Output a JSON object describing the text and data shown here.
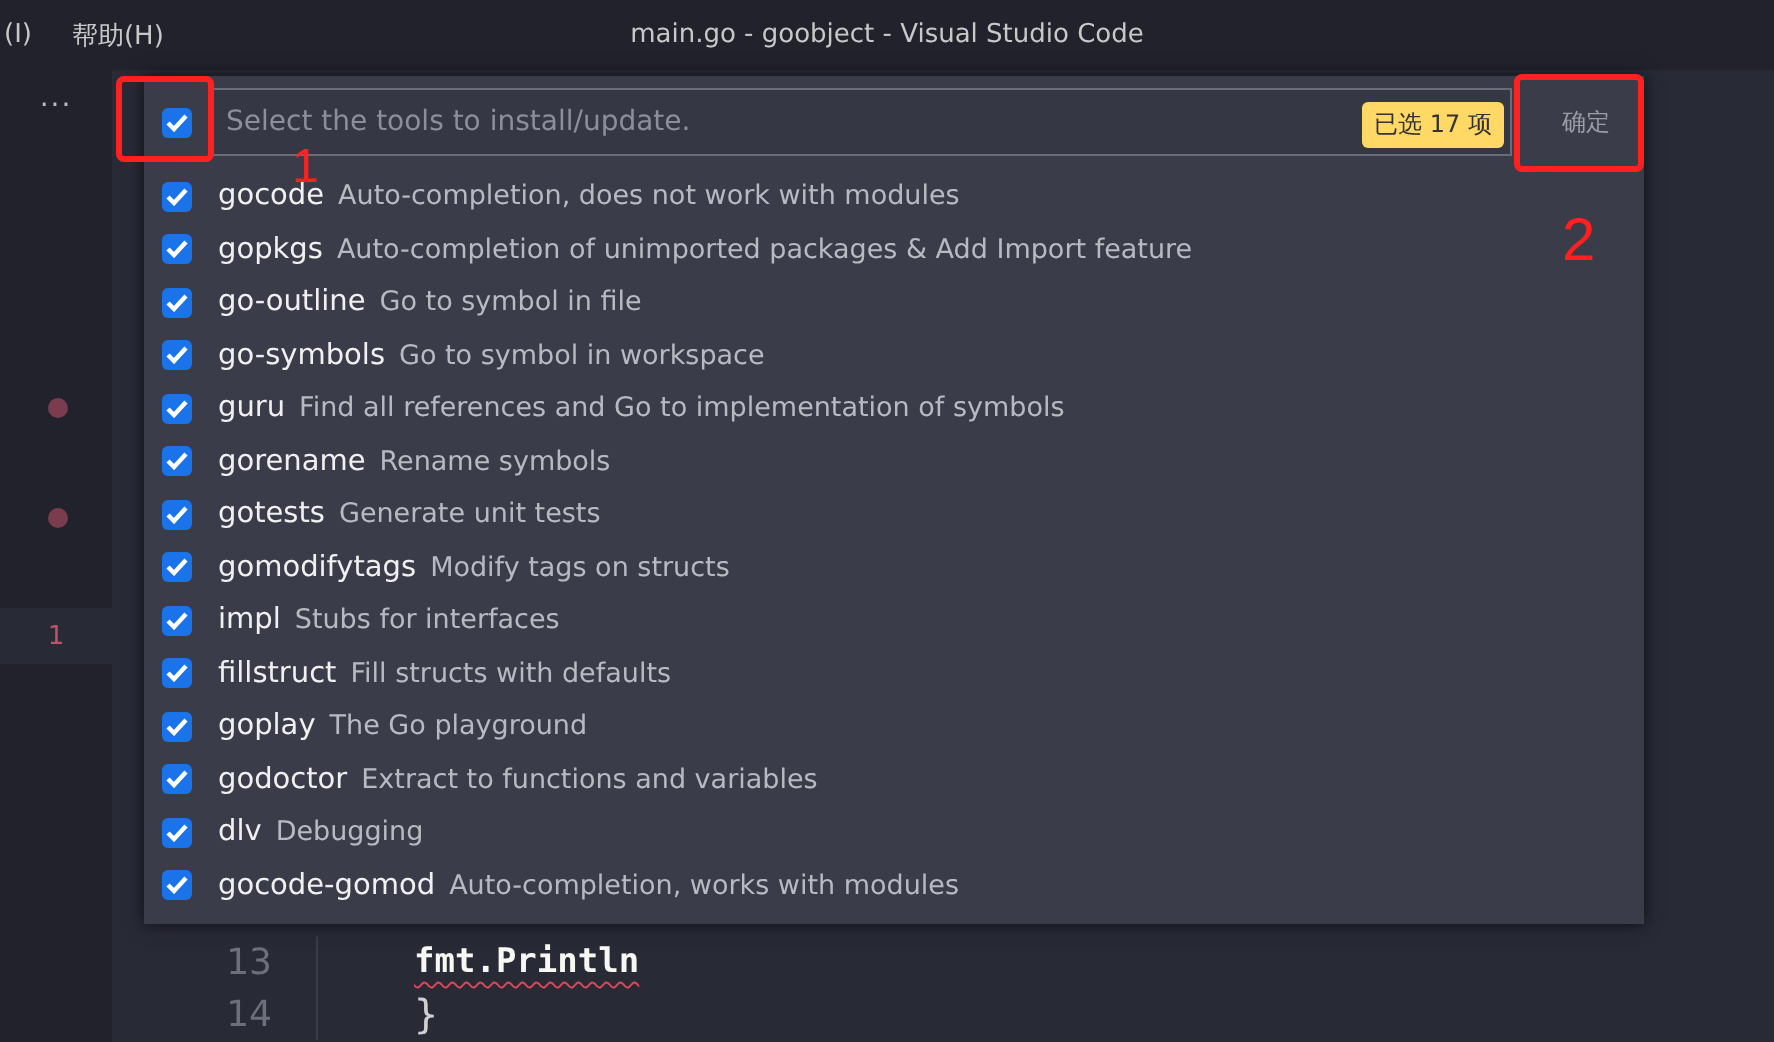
{
  "menu": [
    "(I)",
    "帮助(H)"
  ],
  "window": {
    "title": "main.go - goobject - Visual Studio Code"
  },
  "sidebar": {
    "more": "···",
    "marker_line": "1"
  },
  "quick_pick": {
    "select_all": {
      "checked": true
    },
    "placeholder": "Select the tools to install/update.",
    "badge": "已选 17 项",
    "ok_button": "确定",
    "items": [
      {
        "name": "gocode",
        "description": "Auto-completion, does not work with modules",
        "checked": true
      },
      {
        "name": "gopkgs",
        "description": "Auto-completion of unimported packages & Add Import feature",
        "checked": true
      },
      {
        "name": "go-outline",
        "description": "Go to symbol in file",
        "checked": true
      },
      {
        "name": "go-symbols",
        "description": "Go to symbol in workspace",
        "checked": true
      },
      {
        "name": "guru",
        "description": "Find all references and Go to implementation of symbols",
        "checked": true
      },
      {
        "name": "gorename",
        "description": "Rename symbols",
        "checked": true
      },
      {
        "name": "gotests",
        "description": "Generate unit tests",
        "checked": true
      },
      {
        "name": "gomodifytags",
        "description": "Modify tags on structs",
        "checked": true
      },
      {
        "name": "impl",
        "description": "Stubs for interfaces",
        "checked": true
      },
      {
        "name": "fillstruct",
        "description": "Fill structs with defaults",
        "checked": true
      },
      {
        "name": "goplay",
        "description": "The Go playground",
        "checked": true
      },
      {
        "name": "godoctor",
        "description": "Extract to functions and variables",
        "checked": true
      },
      {
        "name": "dlv",
        "description": "Debugging",
        "checked": true
      },
      {
        "name": "gocode-gomod",
        "description": "Auto-completion, works with modules",
        "checked": true
      }
    ]
  },
  "editor": {
    "lines": [
      {
        "number": "13",
        "code": "fmt.Println",
        "error": true
      },
      {
        "number": "14",
        "code": "}",
        "error": false
      }
    ]
  },
  "annotations": [
    {
      "label": "1"
    },
    {
      "label": "2"
    }
  ]
}
